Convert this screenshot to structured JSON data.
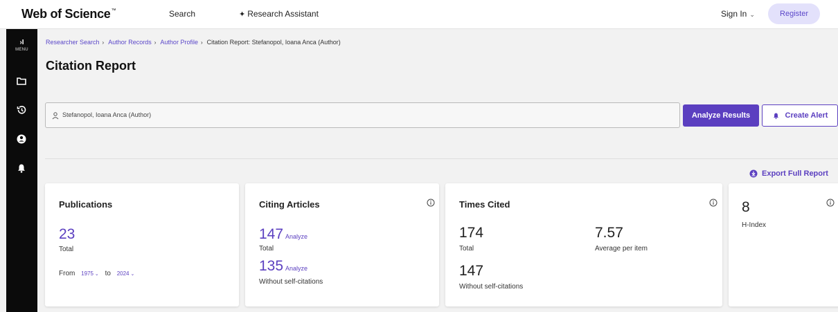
{
  "header": {
    "logo": "Web of Science",
    "logo_tm": "™",
    "search_label": "Search",
    "research_assistant_label": "Research Assistant",
    "signin_label": "Sign In",
    "register_label": "Register"
  },
  "rail": {
    "toggle": "›I",
    "menu_label": "MENU",
    "icons": [
      "folder-icon",
      "history-icon",
      "account-icon",
      "bell-icon"
    ]
  },
  "breadcrumb": {
    "items": [
      "Researcher Search",
      "Author Records",
      "Author Profile"
    ],
    "current": "Citation Report: Stefanopol, Ioana Anca (Author)"
  },
  "page": {
    "title": "Citation Report",
    "query": "Stefanopol, Ioana Anca (Author)",
    "analyze_results_label": "Analyze Results",
    "create_alert_label": "Create Alert",
    "export_label": "Export Full Report"
  },
  "cards": {
    "publications": {
      "title": "Publications",
      "value": "23",
      "value_label": "Total",
      "from_label": "From",
      "from_value": "1975",
      "to_label": "to",
      "to_value": "2024"
    },
    "citing": {
      "title": "Citing Articles",
      "total_value": "147",
      "total_label": "Total",
      "without_value": "135",
      "without_label": "Without self-citations",
      "analyze_label": "Analyze"
    },
    "times_cited": {
      "title": "Times Cited",
      "total_value": "174",
      "total_label": "Total",
      "avg_value": "7.57",
      "avg_label": "Average per item",
      "without_value": "147",
      "without_label": "Without self-citations"
    },
    "hindex": {
      "value": "8",
      "label": "H-Index"
    }
  },
  "colors": {
    "accent": "#5b3fc0",
    "register_bg": "#e3e1fb",
    "rail_bg": "#0b0b0b"
  }
}
